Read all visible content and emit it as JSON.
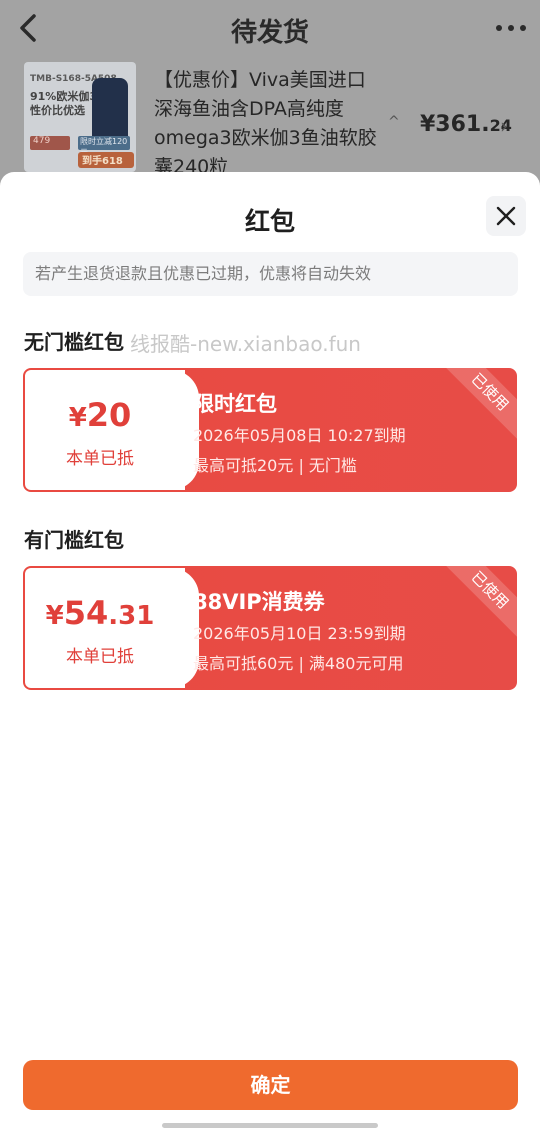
{
  "background_page": {
    "title": "待发货",
    "product_title": "【优惠价】Viva美国进口深海鱼油含DPA高纯度omega3欧米伽3鱼油软胶囊240粒",
    "thumb": {
      "line1": "TMB-S168-5A508",
      "line2": "91%欧米伽3",
      "line3": "性价比优选",
      "badge_price": "479",
      "badge_discount": "限时立减120元",
      "badge_final": "到手618"
    },
    "caret": "^",
    "price_int": "¥361.",
    "price_dec": "24",
    "chevron": "›"
  },
  "sheet": {
    "title": "红包",
    "notice": "若产生退货退款且优惠已过期，优惠将自动失效",
    "watermark": "线报酷-new.xianbao.fun",
    "section_no_threshold": "无门槛红包",
    "section_threshold": "有门槛红包",
    "coupons": [
      {
        "currency": "¥",
        "amount_int": "20",
        "amount_dec": "",
        "applied": "本单已抵",
        "name": "限时红包",
        "expire": "2026年05月08日 10:27到期",
        "limit": "最高可抵20元 | 无门槛",
        "used": "已使用"
      },
      {
        "currency": "¥",
        "amount_int": "54",
        "amount_dec": ".31",
        "applied": "本单已抵",
        "name": "88VIP消费券",
        "expire": "2026年05月10日 23:59到期",
        "limit": "最高可抵60元 | 满480元可用",
        "used": "已使用"
      }
    ],
    "confirm": "确定"
  },
  "colors": {
    "coupon_red": "#e94a41",
    "confirm_orange": "#ef6a2e"
  }
}
